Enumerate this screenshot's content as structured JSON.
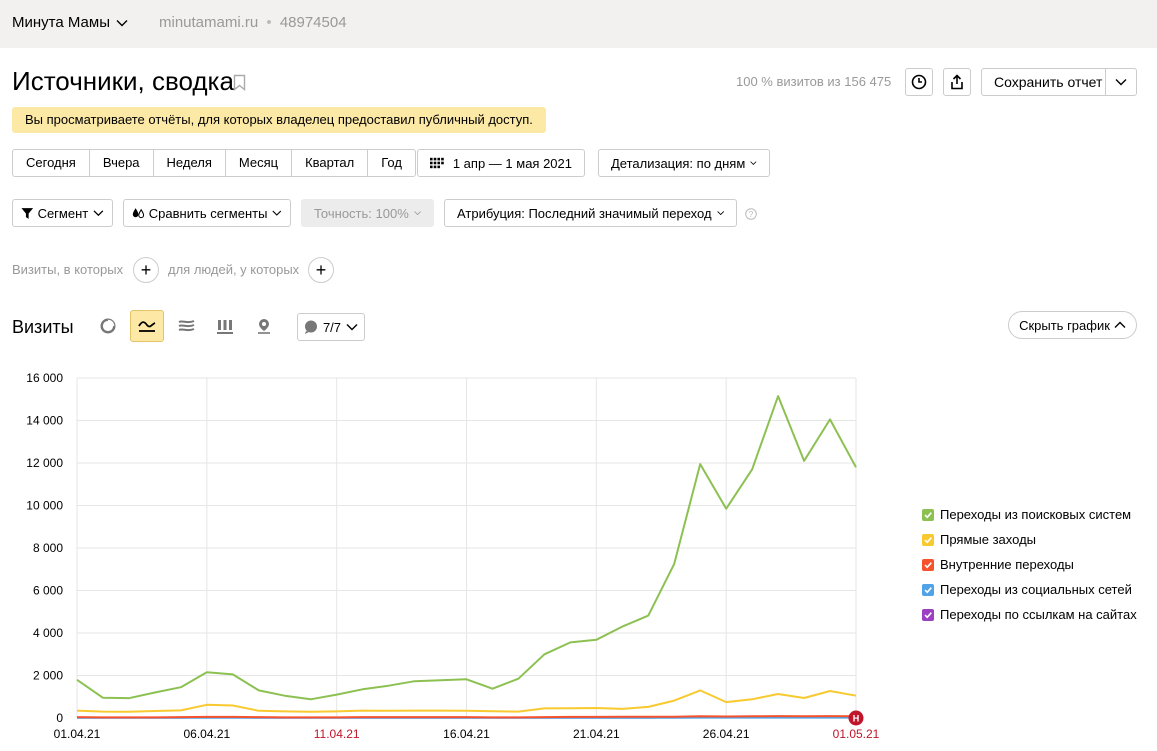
{
  "header": {
    "counter_name": "Минута Мамы",
    "site": "minutamami.ru",
    "separator": "•",
    "counter_id": "48974504"
  },
  "title": "Источники, сводка",
  "visits_total": "100 % визитов из 156 475",
  "save_report": "Сохранить отчет",
  "notice": "Вы просматриваете отчёты, для которых владелец предоставил публичный доступ.",
  "periods": [
    "Сегодня",
    "Вчера",
    "Неделя",
    "Месяц",
    "Квартал",
    "Год"
  ],
  "date_range": "1 апр — 1 мая 2021",
  "detail": "Детализация: по дням",
  "segment": "Сегмент",
  "compare": "Сравнить сегменты",
  "accuracy": "Точность: 100%",
  "attribution": "Атрибуция: Последний значимый переход",
  "filters": {
    "visits_label": "Визиты, в которых",
    "people_label": "для людей, у которых",
    "plus": "+"
  },
  "section_title": "Визиты",
  "notes_count": "7/7",
  "hide_chart": "Скрыть график",
  "colors": {
    "search": "#8cc152",
    "direct": "#f8ca2f",
    "internal": "#f5522d",
    "social": "#4fa3e6",
    "links": "#9d3fc2",
    "holiday": "#c0152b",
    "active_tab": "#fde9a5"
  },
  "chart_data": {
    "type": "line",
    "title": "",
    "xlabel": "",
    "ylabel": "",
    "ylim": [
      0,
      16000
    ],
    "y_ticks": [
      "0",
      "2 000",
      "4 000",
      "6 000",
      "8 000",
      "10 000",
      "12 000",
      "14 000",
      "16 000"
    ],
    "x": [
      "01.04.21",
      "02.04.21",
      "03.04.21",
      "04.04.21",
      "05.04.21",
      "06.04.21",
      "07.04.21",
      "08.04.21",
      "09.04.21",
      "10.04.21",
      "11.04.21",
      "12.04.21",
      "13.04.21",
      "14.04.21",
      "15.04.21",
      "16.04.21",
      "17.04.21",
      "18.04.21",
      "19.04.21",
      "20.04.21",
      "21.04.21",
      "22.04.21",
      "23.04.21",
      "24.04.21",
      "25.04.21",
      "26.04.21",
      "27.04.21",
      "28.04.21",
      "29.04.21",
      "30.04.21",
      "01.05.21"
    ],
    "x_tick_labels": [
      {
        "label": "01.04.21",
        "holiday": false
      },
      {
        "label": "06.04.21",
        "holiday": false
      },
      {
        "label": "11.04.21",
        "holiday": true
      },
      {
        "label": "16.04.21",
        "holiday": false
      },
      {
        "label": "21.04.21",
        "holiday": false
      },
      {
        "label": "26.04.21",
        "holiday": false
      },
      {
        "label": "01.05.21",
        "holiday": true
      }
    ],
    "holiday_marker": "Н",
    "grid": true,
    "legend_position": "right",
    "series": [
      {
        "name": "Переходы из поисковых систем",
        "color": "#8cc152",
        "values": [
          1800,
          950,
          930,
          1200,
          1450,
          2150,
          2050,
          1300,
          1050,
          880,
          1100,
          1350,
          1520,
          1730,
          1780,
          1820,
          1380,
          1850,
          3000,
          3560,
          3680,
          4300,
          4820,
          7250,
          11950,
          9850,
          11700,
          15150,
          12100,
          14050,
          11800
        ]
      },
      {
        "name": "Прямые заходы",
        "color": "#f8ca2f",
        "values": [
          350,
          300,
          290,
          330,
          360,
          620,
          590,
          340,
          310,
          290,
          310,
          350,
          340,
          350,
          350,
          340,
          320,
          300,
          450,
          460,
          470,
          430,
          520,
          820,
          1300,
          750,
          880,
          1130,
          940,
          1270,
          1050
        ]
      },
      {
        "name": "Внутренние переходы",
        "color": "#f5522d",
        "values": [
          40,
          30,
          30,
          30,
          40,
          50,
          50,
          40,
          30,
          30,
          30,
          40,
          40,
          40,
          40,
          40,
          30,
          30,
          40,
          50,
          50,
          60,
          60,
          60,
          80,
          70,
          80,
          90,
          80,
          90,
          80
        ]
      },
      {
        "name": "Переходы из социальных сетей",
        "color": "#4fa3e6",
        "values": [
          10,
          10,
          10,
          10,
          10,
          10,
          10,
          10,
          10,
          10,
          10,
          10,
          10,
          10,
          10,
          10,
          10,
          10,
          10,
          10,
          10,
          10,
          10,
          10,
          20,
          20,
          20,
          20,
          20,
          20,
          20
        ]
      },
      {
        "name": "Переходы по ссылкам на сайтах",
        "color": "#9d3fc2",
        "values": [
          20,
          20,
          20,
          20,
          20,
          30,
          30,
          20,
          20,
          20,
          20,
          20,
          20,
          20,
          20,
          20,
          20,
          20,
          20,
          20,
          20,
          20,
          20,
          30,
          40,
          30,
          40,
          40,
          40,
          40,
          40
        ]
      }
    ]
  }
}
